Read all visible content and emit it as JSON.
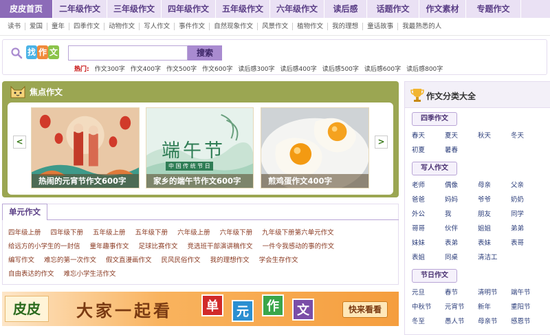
{
  "topnav": [
    "皮皮首页",
    "二年级作文",
    "三年级作文",
    "四年级作文",
    "五年级作文",
    "六年级作文",
    "读后感",
    "话题作文",
    "作文素材",
    "专题作文"
  ],
  "subnav": [
    "读书",
    "爱国",
    "童年",
    "四季作文",
    "动物作文",
    "写人作文",
    "事件作文",
    "自然现象作文",
    "风景作文",
    "植物作文",
    "我的理想",
    "童话故事",
    "我最熟悉的人"
  ],
  "search": {
    "logo": [
      "找",
      "作",
      "文"
    ],
    "value": "",
    "button": "搜索",
    "hot_label": "热门:",
    "hot": [
      "作文300字",
      "作文400字",
      "作文500字",
      "作文600字",
      "读后感300字",
      "读后感400字",
      "读后感500字",
      "读后感600字",
      "读后感800字"
    ]
  },
  "focus": {
    "title": "焦点作文",
    "prev": "<",
    "next": ">",
    "cards": [
      {
        "caption": "热闹的元宵节作文600字"
      },
      {
        "caption": "家乡的端午节作文600字",
        "art_title": "端午节",
        "art_sub": "中 国 传 统 节 日"
      },
      {
        "caption": "煎鸡蛋作文400字"
      }
    ]
  },
  "unit": {
    "tab": "单元作文",
    "rows": [
      [
        "四年级上册",
        "四年级下册",
        "五年级上册",
        "五年级下册",
        "六年级上册",
        "六年级下册",
        "九年级下册第六单元作文"
      ],
      [
        "给远方的小学生的一封信",
        "童年趣事作文",
        "足球比赛作文",
        "竞选班干部演讲稿作文",
        "一件令我感动的事的作文"
      ],
      [
        "编写作文",
        "难忘的第一次作文",
        "假文直漫画作文",
        "民风民俗作文",
        "我的理想作文",
        "学会生存作文"
      ],
      [
        "自由表达的作文",
        "难忘小学生活作文"
      ]
    ]
  },
  "banner": {
    "logo": "皮皮",
    "text": "大家一起看",
    "tiles": [
      "单",
      "元",
      "作",
      "文"
    ],
    "button": "快来看看"
  },
  "sidebar": {
    "title": "作文分类大全",
    "sections": [
      {
        "name": "四季作文",
        "items": [
          "春天",
          "夏天",
          "秋天",
          "冬天",
          "初夏",
          "暑春"
        ]
      },
      {
        "name": "写人作文",
        "items": [
          "老师",
          "偶像",
          "母亲",
          "父亲",
          "爸爸",
          "妈妈",
          "爷爷",
          "奶奶",
          "外公",
          "我",
          "朋友",
          "同学",
          "哥哥",
          "伙伴",
          "姐姐",
          "弟弟",
          "妹妹",
          "表弟",
          "表妹",
          "表哥",
          "表姐",
          "同桌",
          "清洁工"
        ]
      },
      {
        "name": "节日作文",
        "items": [
          "元旦",
          "春节",
          "清明节",
          "端午节",
          "中秋节",
          "元宵节",
          "新年",
          "重阳节",
          "冬至",
          "愚人节",
          "母亲节",
          "感恩节"
        ]
      }
    ]
  },
  "colors": {
    "accent": "#8c6bb8",
    "nav_bg": "#eae1f4",
    "focus_bg": "#9ba652",
    "hot": "#c40000"
  }
}
